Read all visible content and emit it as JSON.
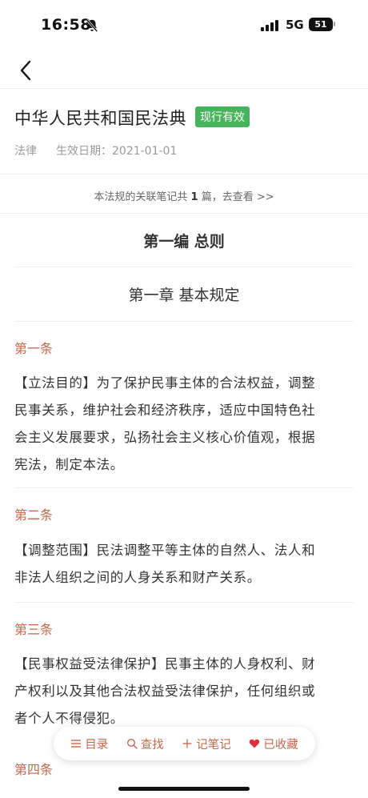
{
  "status_bar": {
    "time": "16:58",
    "network": "5G",
    "battery": "51"
  },
  "law": {
    "title": "中华人民共和国民法典",
    "status": "现行有效",
    "type": "法律",
    "effective_date": "生效日期：2021-01-01"
  },
  "notes_link": {
    "prefix": "本法规的关联笔记共 ",
    "count": "1",
    "suffix": " 篇，去查看 >>"
  },
  "part_title": "第一编 总则",
  "chapter_title": "第一章 基本规定",
  "articles": [
    {
      "title": "第一条",
      "lines": [
        "【立法目的】为了保护民事主体的合法权益，调整",
        "民事关系，维护社会和经济秩序，适应中国特色社",
        "会主义发展要求，弘扬社会主义核心价值观，根据",
        "宪法，制定本法。"
      ]
    },
    {
      "title": "第二条",
      "lines": [
        "【调整范围】民法调整平等主体的自然人、法人和",
        "非法人组织之间的人身关系和财产关系。"
      ]
    },
    {
      "title": "第三条",
      "lines": [
        "【民事权益受法律保护】民事主体的人身权利、财",
        "产权利以及其他合法权益受法律保护，任何组织或",
        "者个人不得侵犯。"
      ]
    },
    {
      "title": "第四条",
      "lines": []
    }
  ],
  "toolbar": {
    "catalog": "目录",
    "search": "查找",
    "note": "记笔记",
    "favorited": "已收藏"
  },
  "colors": {
    "accent": "#c8664a",
    "badge": "#46b45a"
  }
}
